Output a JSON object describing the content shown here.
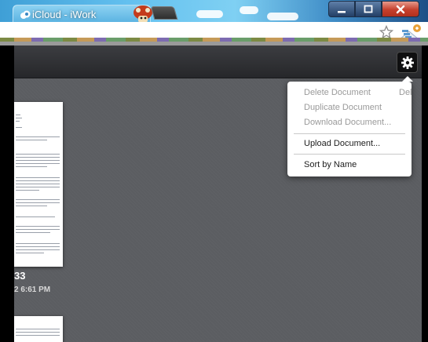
{
  "browser": {
    "tab_title": "iCloud - iWork",
    "colors": {
      "titlebar": "#5cb4e2",
      "close": "#c5402d"
    },
    "window_controls": {
      "minimize": "minimize-icon",
      "maximize": "maximize-icon",
      "close": "close-icon"
    },
    "icons": {
      "bookmark": "star-icon",
      "extension": "extension-icon"
    }
  },
  "toolbar": {
    "settings_icon": "gear-icon"
  },
  "document": {
    "name_fragment": "33",
    "time_fragment": "2 6:61 PM"
  },
  "menu": {
    "items": [
      {
        "label": "Delete Document",
        "enabled": false
      },
      {
        "label": "Duplicate Document",
        "enabled": false
      },
      {
        "label": "Download Document...",
        "enabled": false
      },
      {
        "label": "Upload Document...",
        "enabled": true
      },
      {
        "label": "Sort by Name",
        "enabled": true
      }
    ],
    "delete_shortcut": "Del"
  }
}
